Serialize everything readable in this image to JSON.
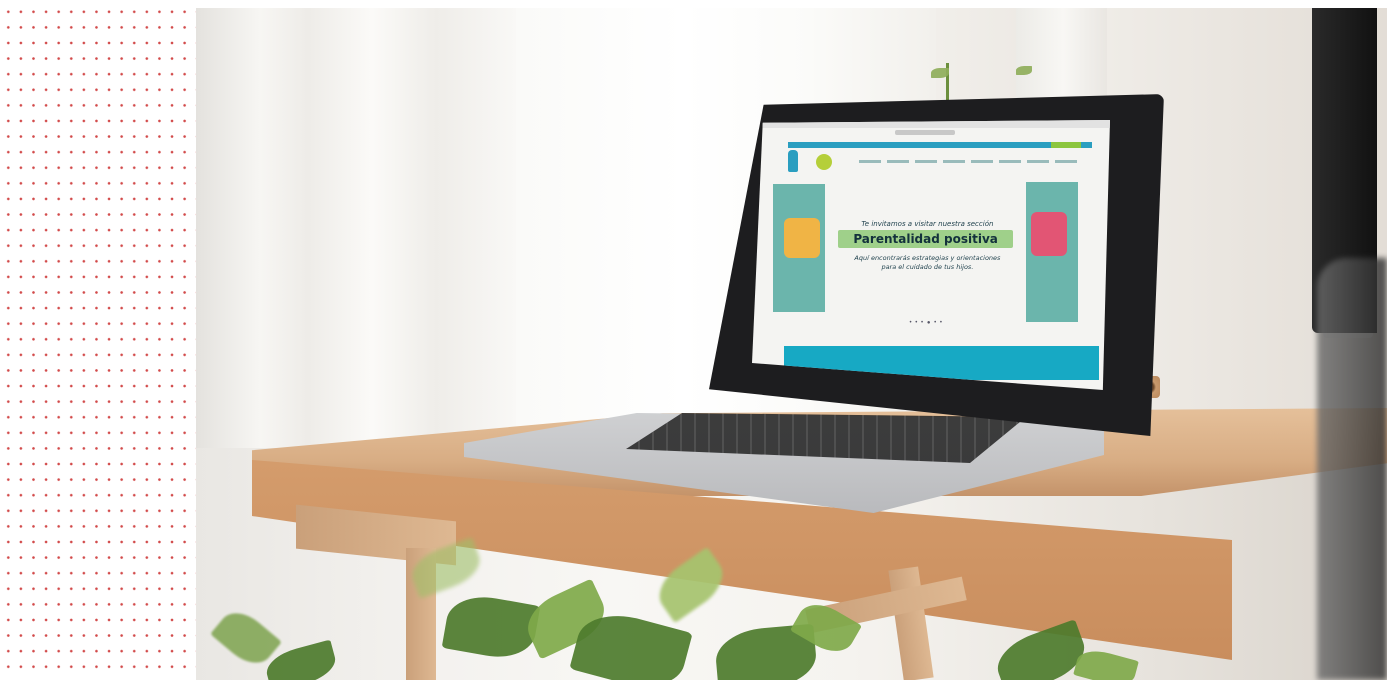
{
  "image": {
    "left_pattern": "red-dot-grid",
    "scene": "laptop-on-wooden-desk"
  },
  "laptop_screen": {
    "intro_text": "Te invitamos a visitar nuestra sección",
    "headline": "Parentalidad positiva",
    "subtext_line1": "Aquí encontrarás estrategias y orientaciones",
    "subtext_line2": "para el cuidado de tus hijos.",
    "slider_dots": "• • • ● • •"
  },
  "colors": {
    "dot": "#d24a4a",
    "teal_panel": "#6bb5ac",
    "banner": "#17a9c4",
    "headline_bg": "#9fd08a",
    "puzzle_left": "#f0b445",
    "puzzle_right": "#e25574",
    "wood": "#d8ad84"
  }
}
